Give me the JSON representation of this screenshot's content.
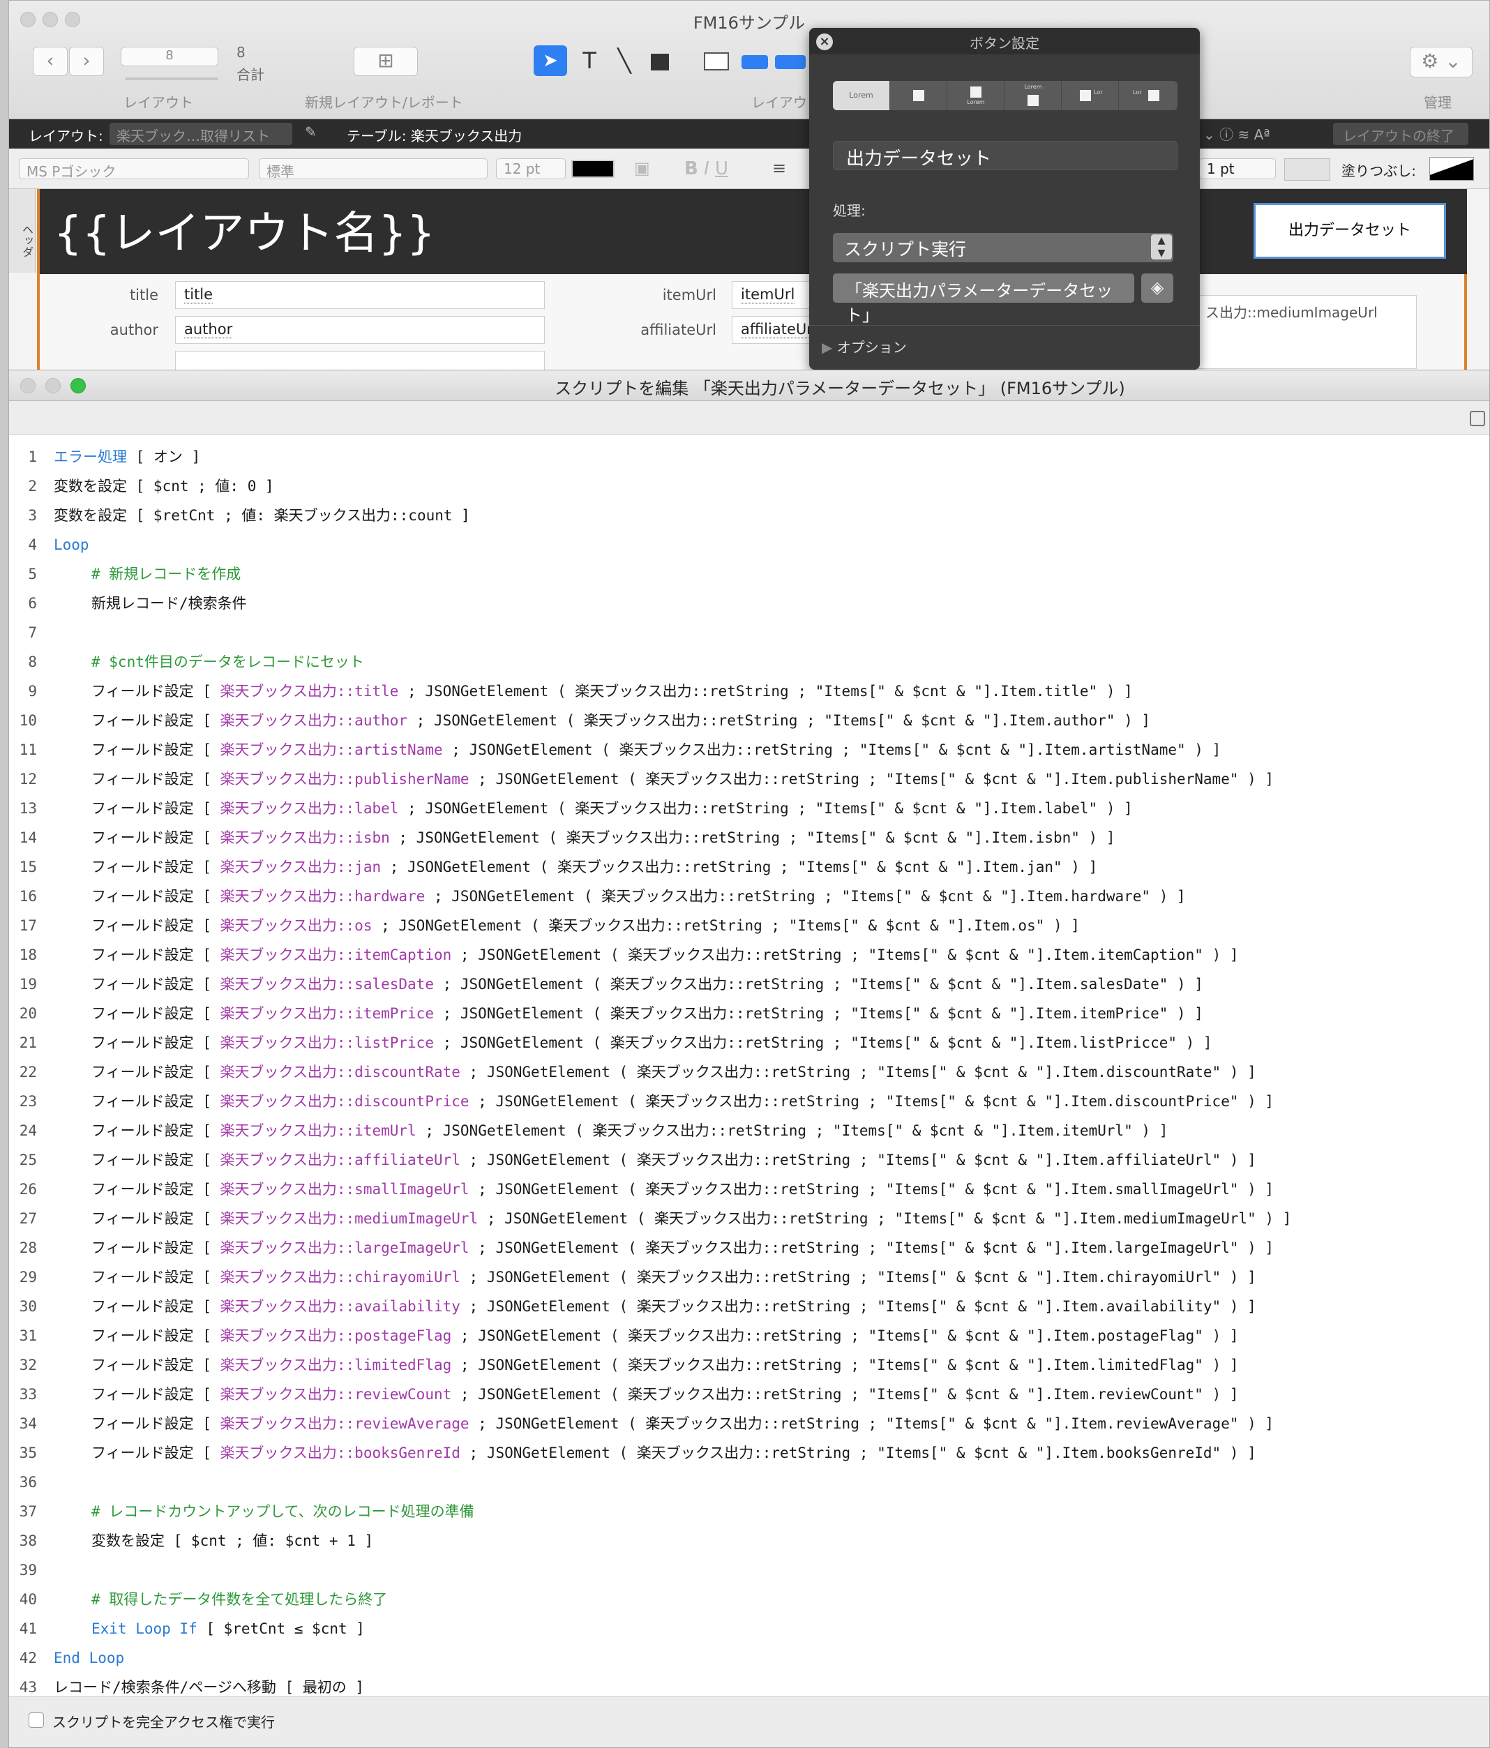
{
  "layout_window": {
    "title": "FM16サンプル",
    "toolbar": {
      "page_field": "8",
      "total_count": "8",
      "total_label": "合計",
      "layout_label": "レイアウト",
      "new_layout_label": "新規レイアウト/レポート",
      "layout_tools_label": "レイアウ",
      "manage_label": "管理"
    },
    "layout_bar": {
      "layout_prefix": "レイアウト:",
      "layout_name": "楽天ブック…取得リスト",
      "table_label": "テーブル: 楽天ブックス出力",
      "exit_layout": "レイアウトの終了"
    },
    "format_bar": {
      "font": "MS Pゴシック",
      "style": "標準",
      "size": "12 pt",
      "line_width": "1 pt",
      "fill_label": "塗りつぶし:"
    },
    "canvas": {
      "header_tab": "ヘッダ",
      "header_title": "{{レイアウト名}}",
      "button_label": "出力データセット",
      "fields": [
        {
          "label": "title",
          "value": "title"
        },
        {
          "label": "author",
          "value": "author"
        },
        {
          "label": "itemUrl",
          "value": "itemUrl"
        },
        {
          "label": "affiliateUrl",
          "value": "affiliateUrl"
        }
      ],
      "image_field": "ス出力::mediumImageUrl"
    }
  },
  "popover": {
    "title": "ボタン設定",
    "style_options": [
      "Lorem",
      "",
      "Lorem",
      "Lorem",
      "Lor",
      "Lor"
    ],
    "label_value": "出力データセット",
    "process_label": "処理:",
    "action_value": "スクリプト実行",
    "script_name": "「楽天出力パラメーターデータセット」",
    "options_label": "オプション"
  },
  "script_window": {
    "title": "スクリプトを編集 「楽天出力パラメーターデータセット」 (FM16サンプル)",
    "footer_checkbox_label": "スクリプトを完全アクセス権で実行",
    "lines": [
      {
        "n": "1",
        "indent": false,
        "parts": [
          [
            "b",
            "エラー処理"
          ],
          [
            "t",
            " [ オン ]"
          ]
        ]
      },
      {
        "n": "2",
        "indent": false,
        "parts": [
          [
            "t",
            "変数を設定 [ $cnt ; 値: 0 ]"
          ]
        ]
      },
      {
        "n": "3",
        "indent": false,
        "parts": [
          [
            "t",
            "変数を設定 [ $retCnt ; 値: 楽天ブックス出力::count ]"
          ]
        ]
      },
      {
        "n": "4",
        "indent": false,
        "parts": [
          [
            "b",
            "Loop"
          ]
        ]
      },
      {
        "n": "5",
        "indent": true,
        "parts": [
          [
            "c",
            "# 新規レコードを作成"
          ]
        ]
      },
      {
        "n": "6",
        "indent": true,
        "parts": [
          [
            "t",
            "新規レコード/検索条件"
          ]
        ]
      },
      {
        "n": "7",
        "indent": true,
        "parts": []
      },
      {
        "n": "8",
        "indent": true,
        "parts": [
          [
            "c",
            "# $cnt件目のデータをレコードにセット"
          ]
        ]
      },
      {
        "n": "9",
        "indent": true,
        "parts": [
          [
            "t",
            "フィールド設定 [ "
          ],
          [
            "f",
            "楽天ブックス出力::title"
          ],
          [
            "t",
            " ; JSONGetElement ( 楽天ブックス出力::retString ; \"Items[\" & $cnt & \"].Item.title\" ) ]"
          ]
        ]
      },
      {
        "n": "10",
        "indent": true,
        "parts": [
          [
            "t",
            "フィールド設定 [ "
          ],
          [
            "f",
            "楽天ブックス出力::author"
          ],
          [
            "t",
            " ; JSONGetElement ( 楽天ブックス出力::retString ; \"Items[\" & $cnt & \"].Item.author\" ) ]"
          ]
        ]
      },
      {
        "n": "11",
        "indent": true,
        "parts": [
          [
            "t",
            "フィールド設定 [ "
          ],
          [
            "f",
            "楽天ブックス出力::artistName"
          ],
          [
            "t",
            " ; JSONGetElement ( 楽天ブックス出力::retString ; \"Items[\" & $cnt & \"].Item.artistName\" ) ]"
          ]
        ]
      },
      {
        "n": "12",
        "indent": true,
        "parts": [
          [
            "t",
            "フィールド設定 [ "
          ],
          [
            "f",
            "楽天ブックス出力::publisherName"
          ],
          [
            "t",
            " ; JSONGetElement ( 楽天ブックス出力::retString ; \"Items[\" & $cnt & \"].Item.publisherName\" ) ]"
          ]
        ]
      },
      {
        "n": "13",
        "indent": true,
        "parts": [
          [
            "t",
            "フィールド設定 [ "
          ],
          [
            "f",
            "楽天ブックス出力::label"
          ],
          [
            "t",
            " ; JSONGetElement ( 楽天ブックス出力::retString ; \"Items[\" & $cnt & \"].Item.label\" ) ]"
          ]
        ]
      },
      {
        "n": "14",
        "indent": true,
        "parts": [
          [
            "t",
            "フィールド設定 [ "
          ],
          [
            "f",
            "楽天ブックス出力::isbn"
          ],
          [
            "t",
            " ; JSONGetElement ( 楽天ブックス出力::retString ; \"Items[\" & $cnt & \"].Item.isbn\" ) ]"
          ]
        ]
      },
      {
        "n": "15",
        "indent": true,
        "parts": [
          [
            "t",
            "フィールド設定 [ "
          ],
          [
            "f",
            "楽天ブックス出力::jan"
          ],
          [
            "t",
            " ; JSONGetElement ( 楽天ブックス出力::retString ; \"Items[\" & $cnt & \"].Item.jan\" ) ]"
          ]
        ]
      },
      {
        "n": "16",
        "indent": true,
        "parts": [
          [
            "t",
            "フィールド設定 [ "
          ],
          [
            "f",
            "楽天ブックス出力::hardware"
          ],
          [
            "t",
            " ; JSONGetElement ( 楽天ブックス出力::retString ; \"Items[\" & $cnt & \"].Item.hardware\" ) ]"
          ]
        ]
      },
      {
        "n": "17",
        "indent": true,
        "parts": [
          [
            "t",
            "フィールド設定 [ "
          ],
          [
            "f",
            "楽天ブックス出力::os"
          ],
          [
            "t",
            " ; JSONGetElement ( 楽天ブックス出力::retString ; \"Items[\" & $cnt & \"].Item.os\" ) ]"
          ]
        ]
      },
      {
        "n": "18",
        "indent": true,
        "parts": [
          [
            "t",
            "フィールド設定 [ "
          ],
          [
            "f",
            "楽天ブックス出力::itemCaption"
          ],
          [
            "t",
            " ; JSONGetElement ( 楽天ブックス出力::retString ; \"Items[\" & $cnt & \"].Item.itemCaption\" ) ]"
          ]
        ]
      },
      {
        "n": "19",
        "indent": true,
        "parts": [
          [
            "t",
            "フィールド設定 [ "
          ],
          [
            "f",
            "楽天ブックス出力::salesDate"
          ],
          [
            "t",
            " ; JSONGetElement ( 楽天ブックス出力::retString ; \"Items[\" & $cnt & \"].Item.salesDate\" ) ]"
          ]
        ]
      },
      {
        "n": "20",
        "indent": true,
        "parts": [
          [
            "t",
            "フィールド設定 [ "
          ],
          [
            "f",
            "楽天ブックス出力::itemPrice"
          ],
          [
            "t",
            " ; JSONGetElement ( 楽天ブックス出力::retString ; \"Items[\" & $cnt & \"].Item.itemPrice\" ) ]"
          ]
        ]
      },
      {
        "n": "21",
        "indent": true,
        "parts": [
          [
            "t",
            "フィールド設定 [ "
          ],
          [
            "f",
            "楽天ブックス出力::listPrice"
          ],
          [
            "t",
            " ; JSONGetElement ( 楽天ブックス出力::retString ; \"Items[\" & $cnt & \"].Item.listPricce\" ) ]"
          ]
        ]
      },
      {
        "n": "22",
        "indent": true,
        "parts": [
          [
            "t",
            "フィールド設定 [ "
          ],
          [
            "f",
            "楽天ブックス出力::discountRate"
          ],
          [
            "t",
            " ; JSONGetElement ( 楽天ブックス出力::retString ; \"Items[\" & $cnt & \"].Item.discountRate\" ) ]"
          ]
        ]
      },
      {
        "n": "23",
        "indent": true,
        "parts": [
          [
            "t",
            "フィールド設定 [ "
          ],
          [
            "f",
            "楽天ブックス出力::discountPrice"
          ],
          [
            "t",
            " ; JSONGetElement ( 楽天ブックス出力::retString ; \"Items[\" & $cnt & \"].Item.discountPrice\" ) ]"
          ]
        ]
      },
      {
        "n": "24",
        "indent": true,
        "parts": [
          [
            "t",
            "フィールド設定 [ "
          ],
          [
            "f",
            "楽天ブックス出力::itemUrl"
          ],
          [
            "t",
            " ; JSONGetElement ( 楽天ブックス出力::retString ; \"Items[\" & $cnt & \"].Item.itemUrl\" ) ]"
          ]
        ]
      },
      {
        "n": "25",
        "indent": true,
        "parts": [
          [
            "t",
            "フィールド設定 [ "
          ],
          [
            "f",
            "楽天ブックス出力::affiliateUrl"
          ],
          [
            "t",
            " ; JSONGetElement ( 楽天ブックス出力::retString ; \"Items[\" & $cnt & \"].Item.affiliateUrl\" ) ]"
          ]
        ]
      },
      {
        "n": "26",
        "indent": true,
        "parts": [
          [
            "t",
            "フィールド設定 [ "
          ],
          [
            "f",
            "楽天ブックス出力::smallImageUrl"
          ],
          [
            "t",
            " ; JSONGetElement ( 楽天ブックス出力::retString ; \"Items[\" & $cnt & \"].Item.smallImageUrl\" ) ]"
          ]
        ]
      },
      {
        "n": "27",
        "indent": true,
        "parts": [
          [
            "t",
            "フィールド設定 [ "
          ],
          [
            "f",
            "楽天ブックス出力::mediumImageUrl"
          ],
          [
            "t",
            " ; JSONGetElement ( 楽天ブックス出力::retString ; \"Items[\" & $cnt & \"].Item.mediumImageUrl\" ) ]"
          ]
        ]
      },
      {
        "n": "28",
        "indent": true,
        "parts": [
          [
            "t",
            "フィールド設定 [ "
          ],
          [
            "f",
            "楽天ブックス出力::largeImageUrl"
          ],
          [
            "t",
            " ; JSONGetElement ( 楽天ブックス出力::retString ; \"Items[\" & $cnt & \"].Item.largeImageUrl\" ) ]"
          ]
        ]
      },
      {
        "n": "29",
        "indent": true,
        "parts": [
          [
            "t",
            "フィールド設定 [ "
          ],
          [
            "f",
            "楽天ブックス出力::chirayomiUrl"
          ],
          [
            "t",
            " ; JSONGetElement ( 楽天ブックス出力::retString ; \"Items[\" & $cnt & \"].Item.chirayomiUrl\" ) ]"
          ]
        ]
      },
      {
        "n": "30",
        "indent": true,
        "parts": [
          [
            "t",
            "フィールド設定 [ "
          ],
          [
            "f",
            "楽天ブックス出力::availability"
          ],
          [
            "t",
            " ; JSONGetElement ( 楽天ブックス出力::retString ; \"Items[\" & $cnt & \"].Item.availability\" ) ]"
          ]
        ]
      },
      {
        "n": "31",
        "indent": true,
        "parts": [
          [
            "t",
            "フィールド設定 [ "
          ],
          [
            "f",
            "楽天ブックス出力::postageFlag"
          ],
          [
            "t",
            " ; JSONGetElement ( 楽天ブックス出力::retString ; \"Items[\" & $cnt & \"].Item.postageFlag\" ) ]"
          ]
        ]
      },
      {
        "n": "32",
        "indent": true,
        "parts": [
          [
            "t",
            "フィールド設定 [ "
          ],
          [
            "f",
            "楽天ブックス出力::limitedFlag"
          ],
          [
            "t",
            " ; JSONGetElement ( 楽天ブックス出力::retString ; \"Items[\" & $cnt & \"].Item.limitedFlag\" ) ]"
          ]
        ]
      },
      {
        "n": "33",
        "indent": true,
        "parts": [
          [
            "t",
            "フィールド設定 [ "
          ],
          [
            "f",
            "楽天ブックス出力::reviewCount"
          ],
          [
            "t",
            " ; JSONGetElement ( 楽天ブックス出力::retString ; \"Items[\" & $cnt & \"].Item.reviewCount\" ) ]"
          ]
        ]
      },
      {
        "n": "34",
        "indent": true,
        "parts": [
          [
            "t",
            "フィールド設定 [ "
          ],
          [
            "f",
            "楽天ブックス出力::reviewAverage"
          ],
          [
            "t",
            " ; JSONGetElement ( 楽天ブックス出力::retString ; \"Items[\" & $cnt & \"].Item.reviewAverage\" ) ]"
          ]
        ]
      },
      {
        "n": "35",
        "indent": true,
        "parts": [
          [
            "t",
            "フィールド設定 [ "
          ],
          [
            "f",
            "楽天ブックス出力::booksGenreId"
          ],
          [
            "t",
            " ; JSONGetElement ( 楽天ブックス出力::retString ; \"Items[\" & $cnt & \"].Item.booksGenreId\" ) ]"
          ]
        ]
      },
      {
        "n": "36",
        "indent": true,
        "parts": []
      },
      {
        "n": "37",
        "indent": true,
        "parts": [
          [
            "c",
            "# レコードカウントアップして、次のレコード処理の準備"
          ]
        ]
      },
      {
        "n": "38",
        "indent": true,
        "parts": [
          [
            "t",
            "変数を設定 [ $cnt ; 値: $cnt + 1 ]"
          ]
        ]
      },
      {
        "n": "39",
        "indent": true,
        "parts": []
      },
      {
        "n": "40",
        "indent": true,
        "parts": [
          [
            "c",
            "# 取得したデータ件数を全て処理したら終了"
          ]
        ]
      },
      {
        "n": "41",
        "indent": true,
        "parts": [
          [
            "b",
            "Exit Loop If"
          ],
          [
            "t",
            " [ $retCnt ≤ $cnt ]"
          ]
        ]
      },
      {
        "n": "42",
        "indent": false,
        "parts": [
          [
            "b",
            "End Loop"
          ]
        ]
      },
      {
        "n": "43",
        "indent": false,
        "parts": [
          [
            "t",
            "レコード/検索条件/ページへ移動 [ 最初の ]"
          ]
        ]
      }
    ]
  }
}
